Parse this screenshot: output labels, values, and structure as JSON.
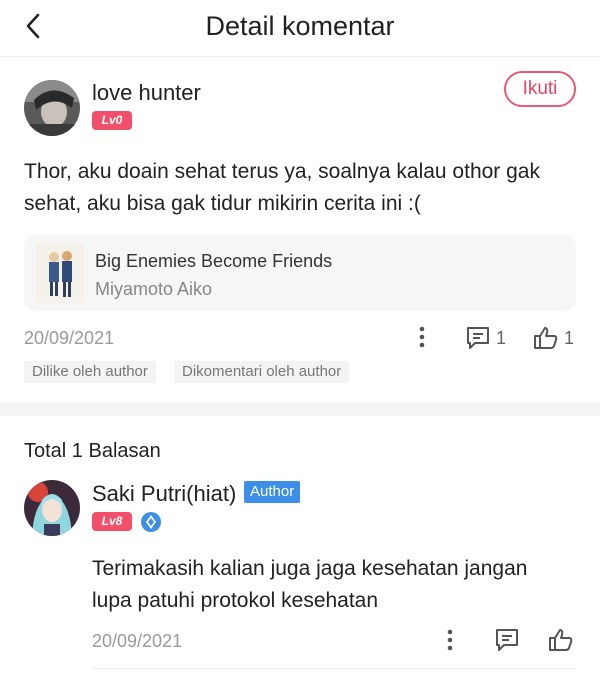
{
  "header": {
    "title": "Detail komentar"
  },
  "comment": {
    "username": "love hunter",
    "level": "Lv0",
    "follow_label": "Ikuti",
    "text": "Thor, aku doain sehat terus ya, soalnya kalau othor gak sehat, aku bisa gak tidur mikirin cerita ini :(",
    "book": {
      "title": "Big Enemies Become Friends",
      "author": "Miyamoto Aiko"
    },
    "date": "20/09/2021",
    "reply_count": "1",
    "like_count": "1",
    "tags": [
      "Dilike oleh author",
      "Dikomentari oleh author"
    ]
  },
  "replies": {
    "title": "Total 1 Balasan",
    "items": [
      {
        "username": "Saki Putri(hiat)",
        "role_badge": "Author",
        "level": "Lv8",
        "text": "Terimakasih kalian juga jaga kesehatan jangan lupa patuhi protokol kesehatan",
        "date": "20/09/2021"
      }
    ]
  },
  "colors": {
    "accent": "#e8445f",
    "level_badge": "#f2506a",
    "author_badge": "#3d8fe6"
  },
  "icons": [
    "back-arrow-icon",
    "more-vertical-icon",
    "comment-icon",
    "thumbs-up-icon",
    "verified-icon"
  ]
}
